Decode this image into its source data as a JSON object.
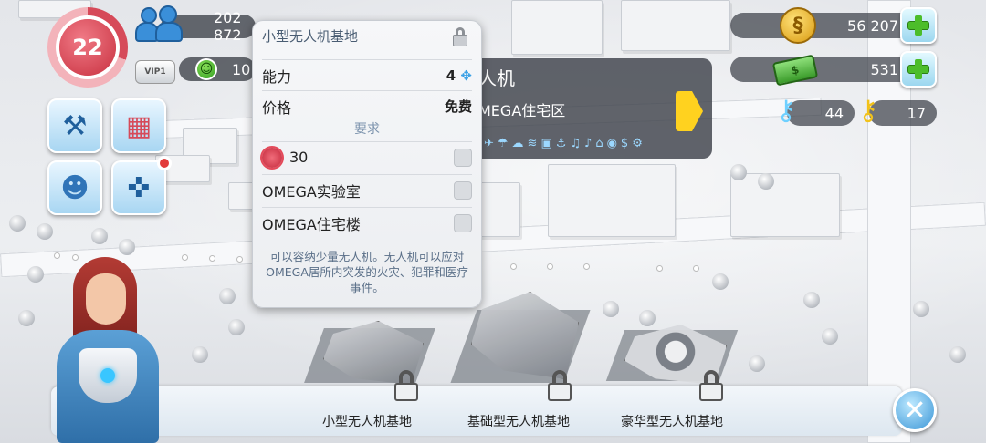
{
  "hud": {
    "level": "22",
    "vip_label": "VIP1",
    "population": "202 872",
    "happiness": "10",
    "simoleons": "56 207",
    "simcash": "531",
    "keys_platinum": "44",
    "keys_golden": "17"
  },
  "info_panel": {
    "title_partial": "人机",
    "subtitle_partial": "MEGA住宅区",
    "service_icons": "✈☂☁≋▣⚓♫♪⌂◉$⚙"
  },
  "popup": {
    "title": "小型无人机基地",
    "capacity_label": "能力",
    "capacity_value": "4",
    "price_label": "价格",
    "price_value": "免费",
    "requirements_header": "要求",
    "requirements": [
      {
        "label": "30"
      },
      {
        "label": "OMEGA实验室"
      },
      {
        "label": "OMEGA住宅楼"
      }
    ],
    "description": "可以容纳少量无人机。无人机可以应对OMEGA居所内突发的火灾、犯罪和医疗事件。"
  },
  "bottom_bar": {
    "items": [
      {
        "label": "小型无人机基地"
      },
      {
        "label": "基础型无人机基地"
      },
      {
        "label": "豪华型无人机基地"
      }
    ]
  },
  "colors": {
    "level_red": "#d64a59",
    "tile_blue": "#a8d6f2",
    "accent_green": "#4cbd2a",
    "arrow_yellow": "#ffd21f",
    "dark_bar": "#3c4048"
  },
  "icons": {
    "population": "people-icon",
    "happiness": "smile-icon",
    "simoleon": "coin-icon",
    "simcash": "banknote-icon",
    "platinum_key": "platinum-key-icon",
    "golden_key": "golden-key-icon",
    "tools": "tools-icon",
    "calendar": "calendar-icon",
    "friends": "friends-icon",
    "gamepad": "gamepad-icon",
    "close": "close-icon",
    "lock": "lock-icon",
    "drone": "drone-icon"
  }
}
